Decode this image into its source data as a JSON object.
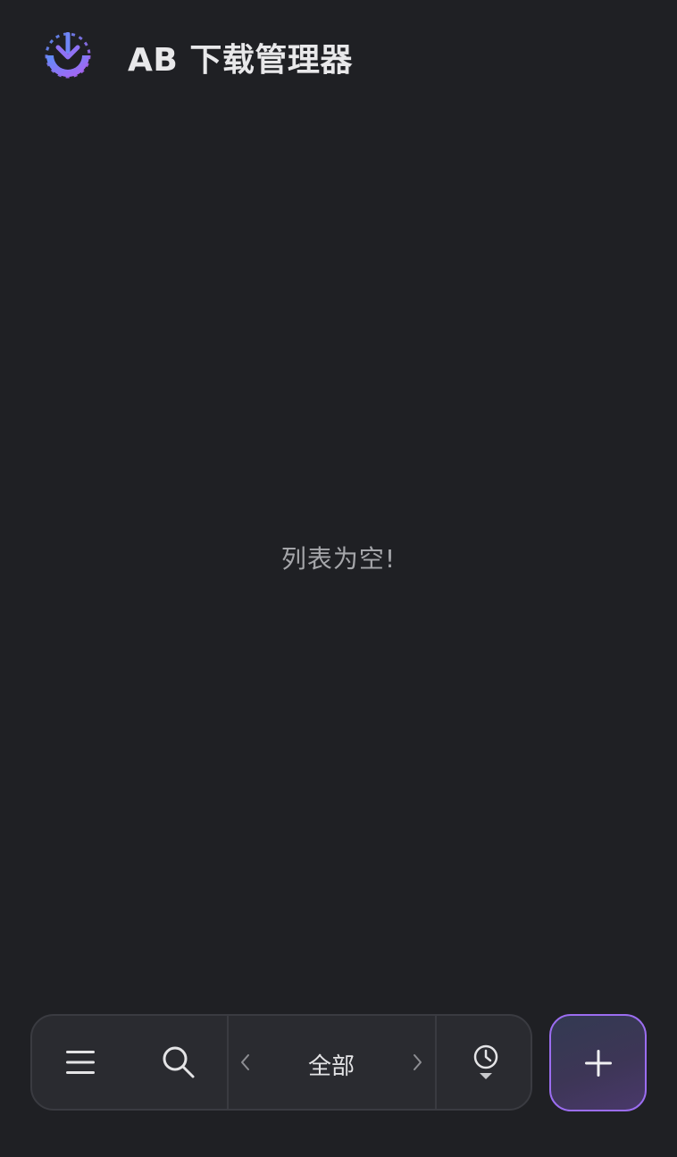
{
  "app": {
    "title": "AB 下载管理器",
    "logo_icon": "download-logo-icon"
  },
  "main": {
    "empty_message": "列表为空!"
  },
  "toolbar": {
    "menu_icon": "hamburger-menu-icon",
    "search_icon": "search-icon",
    "prev_icon": "chevron-left-icon",
    "filter_label": "全部",
    "next_icon": "chevron-right-icon",
    "schedule_icon": "clock-dropdown-icon"
  },
  "fab": {
    "icon": "plus-icon"
  },
  "colors": {
    "background": "#1f2024",
    "toolbar_bg": "#2a2b30",
    "toolbar_border": "#3a3b41",
    "accent_purple": "#9b6df0",
    "accent_blue": "#5b8ff9",
    "text_primary": "#e8e8ea",
    "text_muted": "#a5a6aa"
  }
}
